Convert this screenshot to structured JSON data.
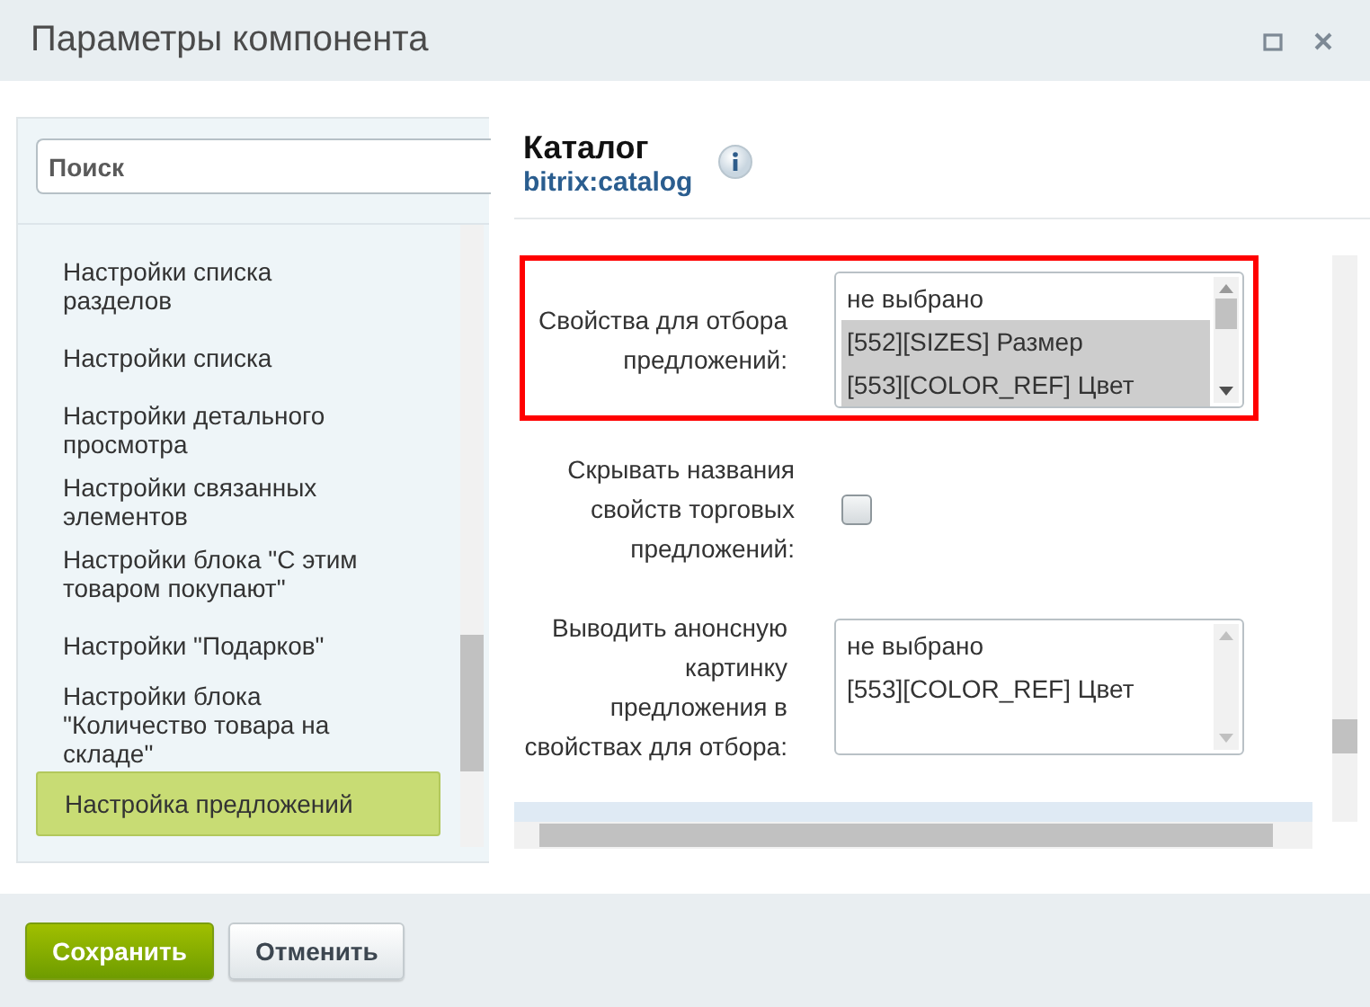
{
  "window": {
    "title": "Параметры компонента"
  },
  "sidebar": {
    "search": {
      "placeholder": "Поиск"
    },
    "items": [
      {
        "label": "Настройки списка разделов",
        "selected": false
      },
      {
        "label": "Настройки списка",
        "selected": false
      },
      {
        "label": "Настройки детального просмотра",
        "selected": false
      },
      {
        "label": "Настройки связанных элементов",
        "selected": false
      },
      {
        "label": "Настройки блока \"С этим товаром покупают\"",
        "selected": false
      },
      {
        "label": "Настройки \"Подарков\"",
        "selected": false
      },
      {
        "label": "Настройки блока \"Количество товара на складе\"",
        "selected": false
      },
      {
        "label": "Настройка предложений",
        "selected": true
      }
    ]
  },
  "component": {
    "title": "Каталог",
    "code": "bitrix:catalog"
  },
  "fields": [
    {
      "kind": "multiselect",
      "label": "Свойства для отбора предложений:",
      "highlighted": true,
      "options": [
        {
          "label": "не выбрано",
          "selected": false
        },
        {
          "label": "[552][SIZES] Размер",
          "selected": true
        },
        {
          "label": "[553][COLOR_REF] Цвет",
          "selected": true
        }
      ]
    },
    {
      "kind": "checkbox",
      "label": "Скрывать названия свойств торговых предложений:",
      "checked": false,
      "highlighted": false
    },
    {
      "kind": "multiselect",
      "label": "Выводить анонсную картинку предложения в свойствах для отбора:",
      "highlighted": false,
      "options": [
        {
          "label": "не выбрано",
          "selected": false
        },
        {
          "label": "[553][COLOR_REF] Цвет",
          "selected": false
        }
      ]
    }
  ],
  "buttons": [
    {
      "label": "Сохранить",
      "kind": "primary"
    },
    {
      "label": "Отменить",
      "kind": "secondary"
    }
  ]
}
